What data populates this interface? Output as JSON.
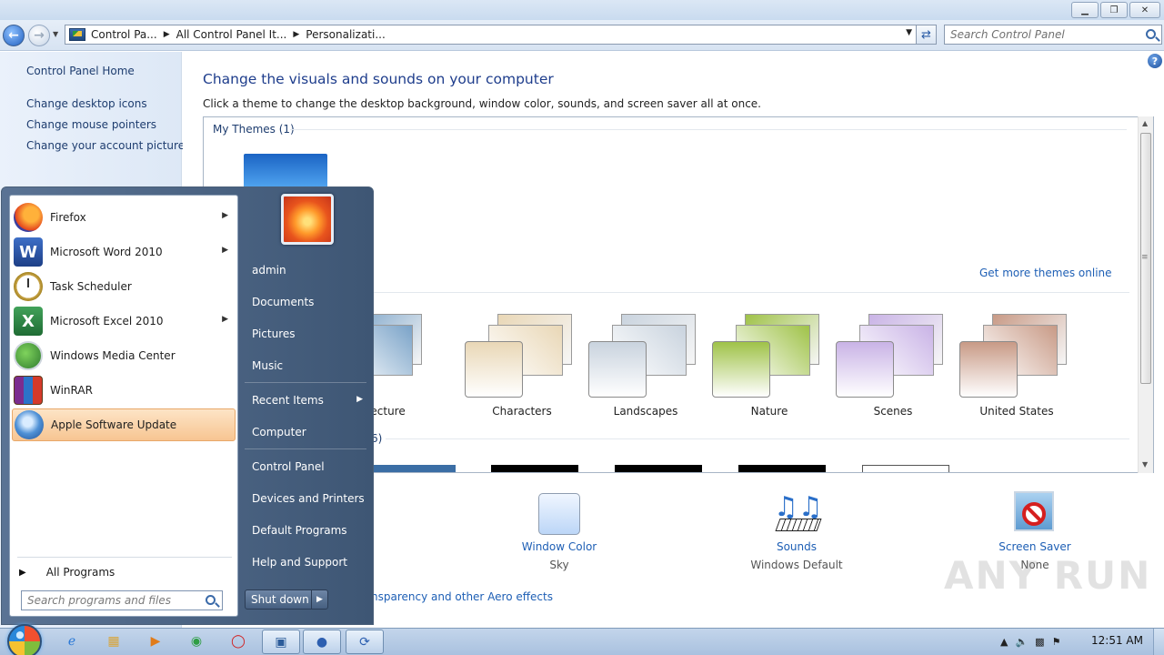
{
  "window": {
    "title_buttons": {
      "minimize": "▁",
      "maximize": "❐",
      "close": "✕"
    }
  },
  "navigation": {
    "breadcrumbs": [
      "Control Pa...",
      "All Control Panel It...",
      "Personalizati..."
    ],
    "search_placeholder": "Search Control Panel"
  },
  "left_pane": {
    "home": "Control Panel Home",
    "links": [
      "Change desktop icons",
      "Change mouse pointers",
      "Change your account picture"
    ]
  },
  "main": {
    "title": "Change the visuals and sounds on your computer",
    "subtitle": "Click a theme to change the desktop background, window color, sounds, and screen saver all at once.",
    "my_themes_header": "My Themes (1)",
    "get_more": "Get more themes online",
    "basic_group_count": "6)",
    "themes": [
      {
        "name": "Architecture",
        "color": "#7aa3c8"
      },
      {
        "name": "Characters",
        "color": "#e9d7b6"
      },
      {
        "name": "Landscapes",
        "color": "#c9d3de"
      },
      {
        "name": "Nature",
        "color": "#9fc248"
      },
      {
        "name": "Scenes",
        "color": "#c9b3e6"
      },
      {
        "name": "United States",
        "color": "#c89a86"
      }
    ],
    "bottom": {
      "window_color_label": "Window Color",
      "window_color_value": "Sky",
      "sounds_label": "Sounds",
      "sounds_value": "Windows Default",
      "screen_saver_label": "Screen Saver",
      "screen_saver_value": "None"
    },
    "aero_link": "nsparency and other Aero effects",
    "watermark": "ANY RUN"
  },
  "start_menu": {
    "programs": [
      {
        "label": "Firefox",
        "icon": "firefox-icon",
        "has_submenu": true
      },
      {
        "label": "Microsoft Word 2010",
        "icon": "word-icon",
        "has_submenu": true
      },
      {
        "label": "Task Scheduler",
        "icon": "clock-icon",
        "has_submenu": false
      },
      {
        "label": "Microsoft Excel 2010",
        "icon": "excel-icon",
        "has_submenu": true
      },
      {
        "label": "Windows Media Center",
        "icon": "media-center-icon",
        "has_submenu": false
      },
      {
        "label": "WinRAR",
        "icon": "winrar-icon",
        "has_submenu": false
      },
      {
        "label": "Apple Software Update",
        "icon": "apple-update-icon",
        "has_submenu": false,
        "highlighted": true
      }
    ],
    "all_programs": "All Programs",
    "search_placeholder": "Search programs and files",
    "right_items": [
      "admin",
      "Documents",
      "Pictures",
      "Music",
      "Recent Items",
      "Computer",
      "Control Panel",
      "Devices and Printers",
      "Default Programs",
      "Help and Support"
    ],
    "shutdown": "Shut down"
  },
  "taskbar": {
    "clock": "12:51 AM"
  }
}
